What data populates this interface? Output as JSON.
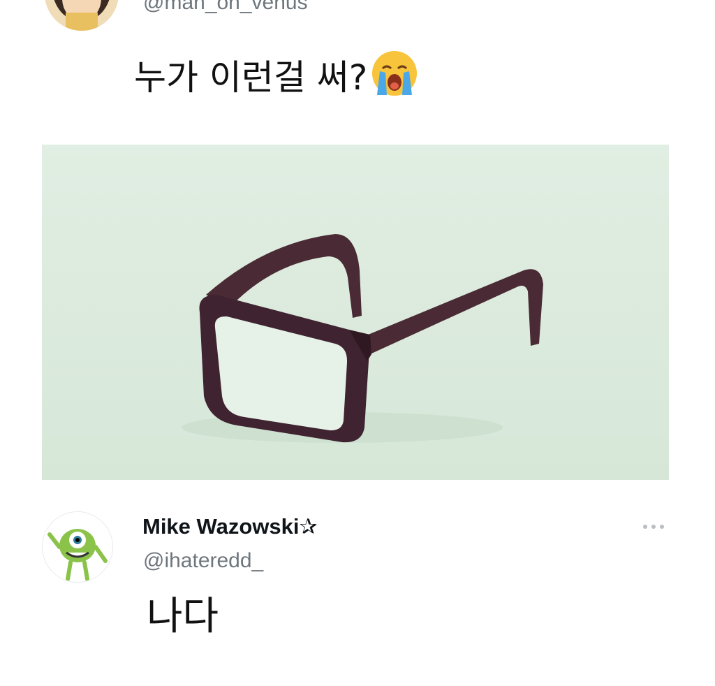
{
  "original_post": {
    "handle": "@man_on_venus",
    "text": "누가 이런걸 써?",
    "emoji": "loudly-crying-face-emoji"
  },
  "media": {
    "description_icon": "glasses-photo"
  },
  "reply": {
    "name": "Mike Wazowski✰",
    "handle": "@ihateredd_",
    "text": "나다",
    "more_icon": "more-dots-icon"
  },
  "colors": {
    "text_primary": "#0f1419",
    "text_secondary": "#6e767d",
    "media_bg": "#dcebde",
    "frame": "#4a2a34"
  }
}
